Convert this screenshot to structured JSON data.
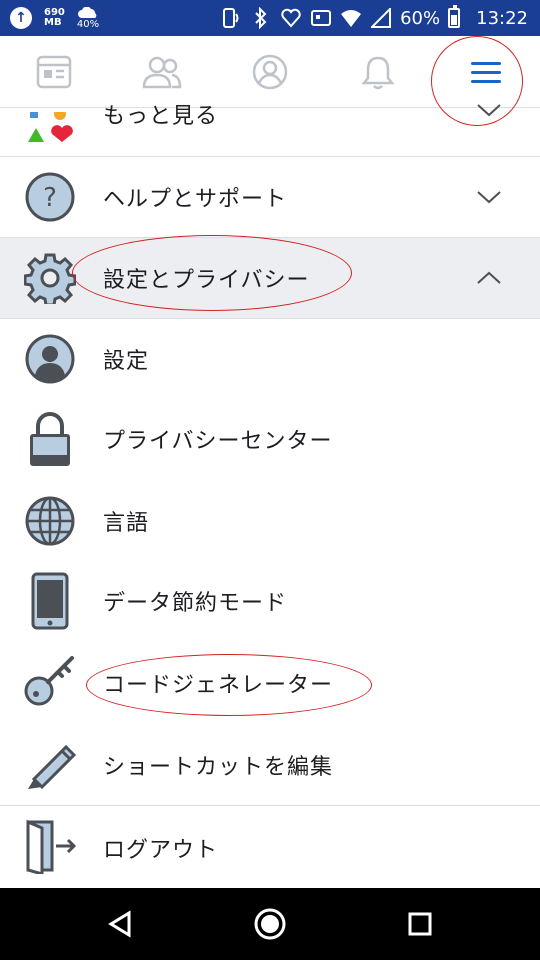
{
  "status_bar": {
    "data_top": "690",
    "data_bottom": "MB",
    "weather": "40%",
    "battery": "60%",
    "time": "13:22"
  },
  "menu": {
    "see_more": "もっと見る",
    "help": "ヘルプとサポート",
    "settings_privacy": "設定とプライバシー",
    "items": [
      {
        "label": "設定",
        "icon": "avatar-icon"
      },
      {
        "label": "プライバシーセンター",
        "icon": "lock-icon"
      },
      {
        "label": "言語",
        "icon": "globe-icon"
      },
      {
        "label": "データ節約モード",
        "icon": "phone-icon"
      },
      {
        "label": "コードジェネレーター",
        "icon": "key-icon"
      },
      {
        "label": "ショートカットを編集",
        "icon": "pencil-icon"
      }
    ],
    "logout": "ログアウト"
  },
  "colors": {
    "status_bar_bg": "#1a3e93",
    "accent_blue": "#1b63c6",
    "annotation_red": "#d32222",
    "expanded_bg": "#edeef2"
  }
}
